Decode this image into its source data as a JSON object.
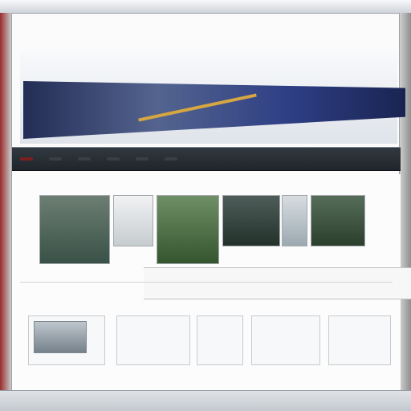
{
  "browser": {
    "status_text": ""
  },
  "hero": {
    "title": "",
    "subtitle": ""
  },
  "nav": {
    "items": [
      "",
      "",
      "",
      "",
      "",
      ""
    ]
  },
  "tiles": [
    {
      "label": ""
    },
    {
      "label": ""
    },
    {
      "label": ""
    },
    {
      "label": ""
    },
    {
      "label": ""
    },
    {
      "label": ""
    }
  ],
  "feature": {
    "left": "",
    "right": ""
  },
  "summary": "",
  "cards": [
    {
      "title": "",
      "link": ""
    },
    {
      "title": "",
      "link": ""
    },
    {
      "title": "",
      "link": ""
    },
    {
      "title": "",
      "link": ""
    },
    {
      "title": "",
      "link": ""
    }
  ],
  "colors": {
    "accent": "#7c1f1f",
    "banner": "#2d3e84",
    "gold": "#d5a642"
  }
}
